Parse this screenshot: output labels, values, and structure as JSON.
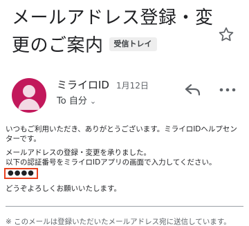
{
  "email": {
    "subject_line1": "メールアドレス登録・変",
    "subject_line2": "更のご案内",
    "label_chip": "受信トレイ",
    "sender_name": "ミライロID",
    "date": "1月12日",
    "to_label": "To 自分",
    "body": {
      "line1": "いつもご利用いただき、ありがとうございます。ミライロIDヘルプセン",
      "line2": "ターです。",
      "line3": "メールアドレスの登録・変更を承りました。",
      "line4": "以下の認証番号をミライロIDアプリの画面で入力してください。",
      "code": "●●●●",
      "line5": "どうぞよろしくお願いいたします。",
      "cutoff_line": "※ このメールは登録いただいたメールアドレス宛に送信しています。"
    }
  },
  "colors": {
    "avatar_bg": "#c2185b",
    "code_border": "#e8411f",
    "icon_gray": "#5f6368"
  },
  "icons": {
    "star": "star-outline-icon",
    "reply": "reply-icon",
    "more": "more-horizontal-icon",
    "avatar": "person-avatar-icon"
  }
}
